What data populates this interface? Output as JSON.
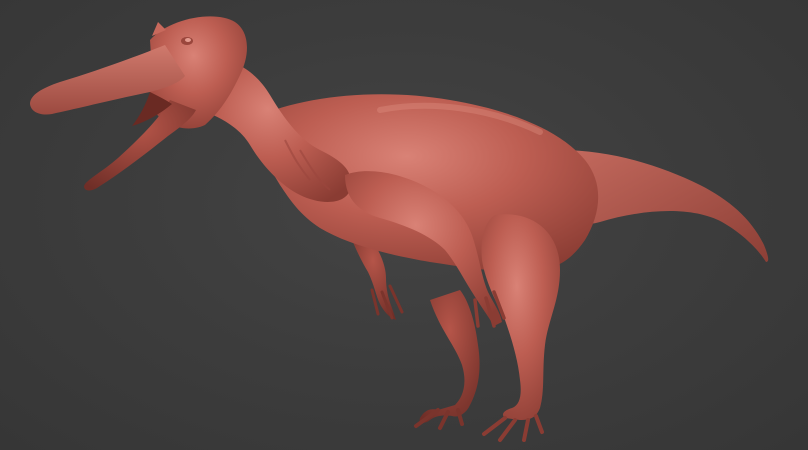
{
  "viewport": {
    "background_color": "#3b3b3b",
    "model": {
      "subject": "spinosaur-sculpt",
      "material": "clay",
      "base_color": "#b85a4e",
      "highlight_color": "#d98276",
      "shadow_color": "#7d342c"
    }
  }
}
